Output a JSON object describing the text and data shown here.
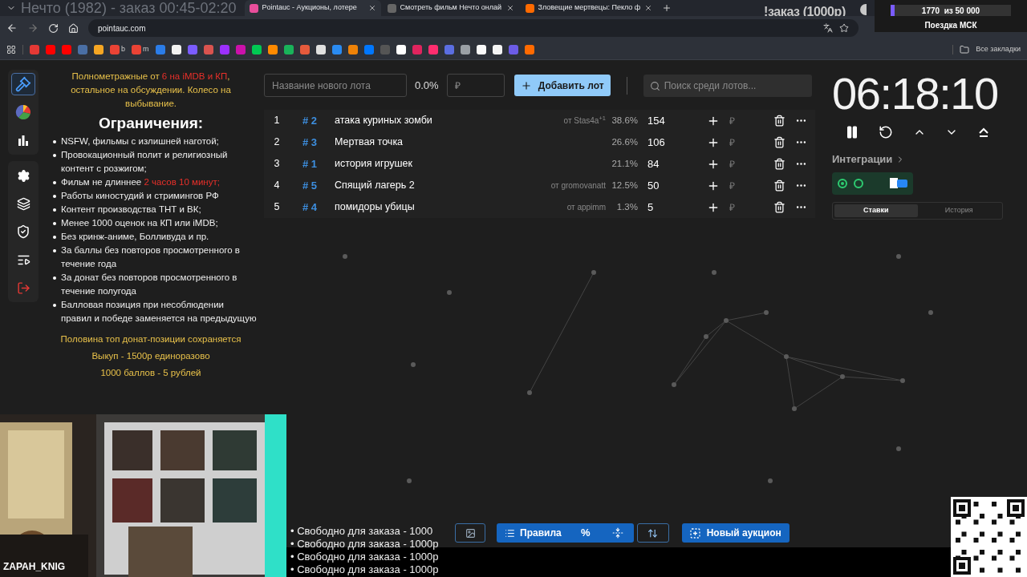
{
  "browser": {
    "overlay_title": "Нечто (1982) - заказ 00:45-02:20",
    "tabs": [
      {
        "title": "Pointauc - Аукционы, лотере",
        "selected": true
      },
      {
        "title": "Смотреть фильм Нечто онлай",
        "selected": false
      },
      {
        "title": "Зловещие мертвецы: Пекло ф",
        "selected": false
      }
    ],
    "address": "pointauc.com",
    "bookmarks": [
      {
        "color": "#e53935"
      },
      {
        "color": "#ff0000"
      },
      {
        "color": "#ff0000"
      },
      {
        "color": "#4a6fa5"
      },
      {
        "color": "#f5a623"
      },
      {
        "color": "#ea4335",
        "label": "b"
      },
      {
        "color": "#ea4335",
        "label": "m"
      },
      {
        "color": "#2b7de9"
      },
      {
        "color": "#f2f2f2"
      },
      {
        "color": "#7b5cff"
      },
      {
        "color": "#d9534f"
      },
      {
        "color": "#9b30ff"
      },
      {
        "color": "#cb11ab"
      },
      {
        "color": "#00c853"
      },
      {
        "color": "#ff8a00"
      },
      {
        "color": "#19b35a"
      },
      {
        "color": "#e55a3c"
      },
      {
        "color": "#e0e0e0"
      },
      {
        "color": "#2a8bf2"
      },
      {
        "color": "#ee8208"
      },
      {
        "color": "#0077ff"
      },
      {
        "color": "#555555"
      },
      {
        "color": "#ffffff"
      },
      {
        "color": "#e0245e"
      },
      {
        "color": "#ff2d6f"
      },
      {
        "color": "#5b6ee1"
      },
      {
        "color": "#9aa0a6"
      },
      {
        "color": "#fafafa"
      },
      {
        "color": "#f4f4f4"
      },
      {
        "color": "#6c5ce7"
      },
      {
        "color": "#ff6a00"
      }
    ],
    "all_bookmarks": "Все закладки"
  },
  "stream_overlay": {
    "order_label": "!заказ (1000р)",
    "goal": {
      "progress": "1770  из 50 000",
      "level": 0.035,
      "name": "Поездка МСК"
    },
    "webcam_name": "ZAPAH_KNIG",
    "queue": [
      "• Свободно для заказа - 1000",
      "• Свободно для заказа - 1000р",
      "• Свободно для заказа - 1000р",
      "• Свободно для заказа - 1000р"
    ]
  },
  "sidebar": {
    "groups": [
      {
        "items": [
          {
            "selected": true
          },
          {
            "selected": false
          },
          {
            "selected": false
          }
        ]
      },
      {
        "items": [
          {
            "selected": false
          },
          {
            "selected": false
          },
          {
            "selected": false
          },
          {
            "selected": false
          },
          {
            "selected": false
          }
        ]
      }
    ]
  },
  "rules": {
    "intro": [
      {
        "text": "Полнометражные от ",
        "highlight": false
      },
      {
        "text": "6 на iMDB и КП",
        "highlight": true
      },
      {
        "text": ", остальное на обсуждении. Колесо на выбывание.",
        "highlight": false
      }
    ],
    "heading": "Ограничения:",
    "items": [
      {
        "parts": [
          {
            "text": "NSFW, фильмы с излишней наготой;",
            "highlight": false
          }
        ]
      },
      {
        "parts": [
          {
            "text": "Провокационный полит и религиозный контент с розжигом;",
            "highlight": false
          }
        ]
      },
      {
        "parts": [
          {
            "text": "Фильм не длиннее ",
            "highlight": false
          },
          {
            "text": "2 часов 10 минут;",
            "highlight": true
          }
        ]
      },
      {
        "parts": [
          {
            "text": "Работы киностудий и стримингов РФ",
            "highlight": false
          }
        ]
      },
      {
        "parts": [
          {
            "text": "Контент производства ТНТ и ВК;",
            "highlight": false
          }
        ]
      },
      {
        "parts": [
          {
            "text": "Менее 1000 оценок на КП или iMDB;",
            "highlight": false
          }
        ]
      },
      {
        "parts": [
          {
            "text": "Без кринж-аниме, Болливуда и пр.",
            "highlight": false
          }
        ]
      },
      {
        "parts": [
          {
            "text": "За баллы без повторов просмотренного в течение года",
            "highlight": false
          }
        ]
      },
      {
        "parts": [
          {
            "text": "За донат без повторов просмотренного в течение полугода",
            "highlight": false
          }
        ]
      },
      {
        "parts": [
          {
            "text": "Балловая позиция при несоблюдении правил и победе заменяется на предыдущую",
            "highlight": false
          }
        ]
      }
    ],
    "notes": [
      "Половина топ донат-позиции сохраняется",
      "Выкуп - 1500р единоразово",
      "1000 баллов - 5 рублей"
    ]
  },
  "lot_form": {
    "name_placeholder": "Название нового лота",
    "percent": "0.0%",
    "price_placeholder": "₽",
    "add_button": "Добавить лот",
    "search_placeholder": "Поиск среди лотов..."
  },
  "lots": [
    {
      "rank": "1",
      "id": "# 2",
      "name": "атака куриных зомби",
      "author": "от Stas4a$^{+1}$",
      "percent": "38.6%",
      "amount": "154",
      "currency": "₽"
    },
    {
      "rank": "2",
      "id": "# 3",
      "name": "Мертвая точка",
      "percent": "26.6%",
      "amount": "106",
      "currency": "₽"
    },
    {
      "rank": "3",
      "id": "# 1",
      "name": "история игрушек",
      "percent": "21.1%",
      "amount": "84",
      "currency": "₽"
    },
    {
      "rank": "4",
      "id": "# 5",
      "name": "Спящий лагерь 2",
      "author": "от gromovanatt",
      "percent": "12.5%",
      "amount": "50",
      "currency": "₽"
    },
    {
      "rank": "5",
      "id": "# 4",
      "name": "помидоры убицы",
      "author": "от appimm",
      "percent": "1.3%",
      "amount": "5",
      "currency": "₽"
    }
  ],
  "timer": {
    "time": "06:18:10",
    "integrations_label": "Интеграции",
    "tabs": [
      {
        "label": "Ставки",
        "selected": true
      },
      {
        "label": "История",
        "selected": false
      }
    ]
  },
  "toolbar": {
    "rules_button": "Правила",
    "percent_button": "%",
    "new_auction_button": "Новый аукцион"
  }
}
